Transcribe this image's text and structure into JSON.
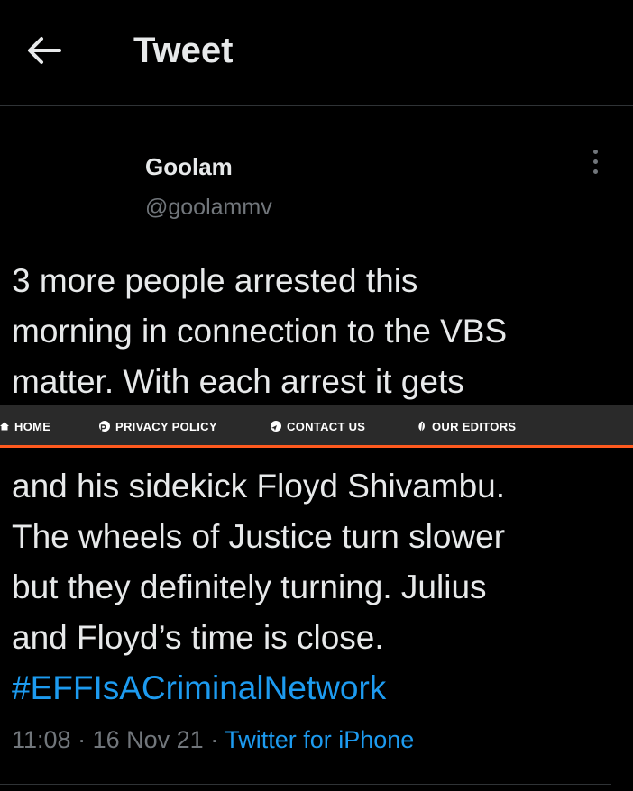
{
  "header": {
    "title": "Tweet",
    "back_icon": "arrow-left-icon"
  },
  "tweet": {
    "author_name": "Goolam",
    "author_handle": "@goolammv",
    "more_icon": "more-vertical-icon",
    "text_lines_top": [
      "3 more people arrested this",
      "morning in connection to the VBS",
      "matter. With each arrest it gets"
    ],
    "text_lines_bottom": [
      "and his sidekick Floyd Shivambu.",
      "The wheels of Justice turn slower",
      "but they definitely turning. Julius",
      "and Floyd’s time is close."
    ],
    "hashtag": "#EFFIsACriminalNetwork",
    "time": "11:08",
    "separator": "·",
    "date": "16 Nov 21",
    "source": "Twitter for iPhone"
  },
  "overlay_nav": {
    "items": [
      {
        "label": "HOME",
        "icon": "home-icon"
      },
      {
        "label": "PRIVACY POLICY",
        "icon": "privacy-icon"
      },
      {
        "label": "CONTACT US",
        "icon": "send-icon"
      },
      {
        "label": "OUR EDITORS",
        "icon": "leaf-icon"
      }
    ],
    "accent_color": "#ff5a1f",
    "background_color": "#2a2a2a"
  },
  "colors": {
    "background": "#000000",
    "text_primary": "#e7e9ea",
    "text_secondary": "#71767b",
    "link": "#1d9bf0"
  }
}
